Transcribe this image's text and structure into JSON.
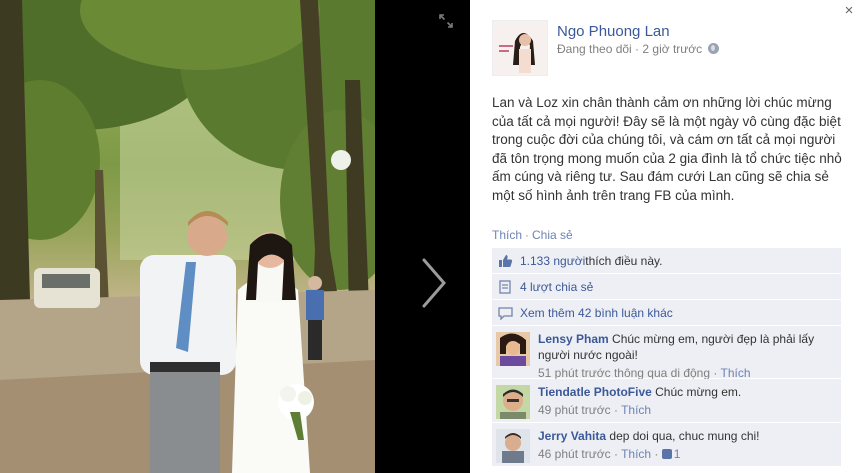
{
  "viewer": {
    "expand_icon": "expand-icon",
    "next_icon": "chevron-right-icon"
  },
  "panel": {
    "close_label": "×",
    "poster_name": "Ngo Phuong Lan",
    "poster_meta": "Đang theo dõi · 2 giờ trước",
    "post_text": "Lan và Loz xin chân thành cảm ơn những lời chúc mừng của tất cả mọi người! Đây sẽ là một ngày vô cùng đặc biệt trong cuộc đời của chúng tôi, và cám ơn tất cả mọi người đã tôn trọng mong muốn của 2 gia đình là tổ chức tiệc nhỏ ấm cúng và riêng tư. Sau đám cưới Lan cũng sẽ chia sẻ một số hình ảnh trên trang FB của mình.",
    "action_like": "Thích",
    "action_share": "Chia sẻ",
    "likes_count": "1.133 người",
    "likes_suffix": " thích điều này.",
    "shares": "4 lượt chia sẻ",
    "view_more": "Xem thêm 42 bình luận khác"
  },
  "comments": [
    {
      "author": "Lensy Pham",
      "text": "Chúc mừng em, người đẹp là phải lấy người nước ngoài!",
      "time": "51 phút trước thông qua di động",
      "like_label": "Thích",
      "like_count": ""
    },
    {
      "author": "Tiendatle PhotoFive",
      "text": "Chúc mừng em.",
      "time": "49 phút trước",
      "like_label": "Thích",
      "like_count": ""
    },
    {
      "author": "Jerry Vahita",
      "text": "dep doi qua, chuc mung chi!",
      "time": "46 phút trước",
      "like_label": "Thích",
      "like_count": "1"
    }
  ],
  "colors": {
    "link": "#3b5998",
    "ufi_bg": "#edeff4",
    "meta": "#808080"
  }
}
